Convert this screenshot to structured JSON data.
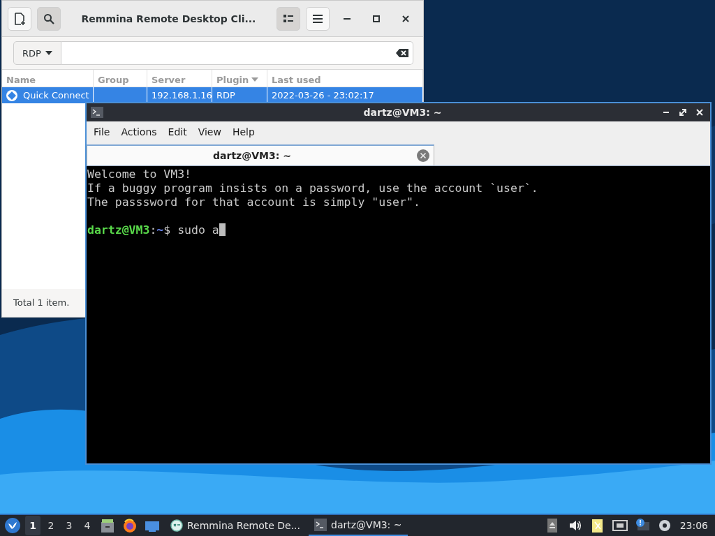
{
  "remmina": {
    "title": "Remmina Remote Desktop Cli...",
    "protocol": "RDP",
    "columns": [
      {
        "label": "Name",
        "sorted": false
      },
      {
        "label": "Group",
        "sorted": false
      },
      {
        "label": "Server",
        "sorted": false
      },
      {
        "label": "Plugin",
        "sorted": true
      },
      {
        "label": "Last used",
        "sorted": false
      }
    ],
    "rows": [
      {
        "cells": [
          "Quick Connect",
          "",
          "192.168.1.16",
          "RDP",
          "2022-03-26 - 23:02:17"
        ],
        "selected": true
      }
    ],
    "status_bar": "Total 1 item."
  },
  "terminal": {
    "title": "dartz@VM3: ~",
    "menu": [
      "File",
      "Actions",
      "Edit",
      "View",
      "Help"
    ],
    "tabs": [
      {
        "label": "dartz@VM3: ~",
        "selected": true
      }
    ],
    "lines": [
      "Welcome to VM3!",
      "If a buggy program insists on a password, use the account `user`.",
      "The passsword for that account is simply \"user\"."
    ],
    "prompt": {
      "user_host": "dartz@VM3",
      "separator": ":",
      "path": "~",
      "symbol": "$",
      "command": "sudo a"
    }
  },
  "taskbar": {
    "workspaces": [
      {
        "label": "1",
        "selected": true
      },
      {
        "label": "2",
        "selected": false
      },
      {
        "label": "3",
        "selected": false
      },
      {
        "label": "4",
        "selected": false
      }
    ],
    "tasks": [
      {
        "label": "Remmina Remote De...",
        "selected": false,
        "kind": "remmina"
      },
      {
        "label": "dartz@VM3: ~",
        "selected": true,
        "kind": "terminal"
      }
    ],
    "clock": "23:06"
  }
}
